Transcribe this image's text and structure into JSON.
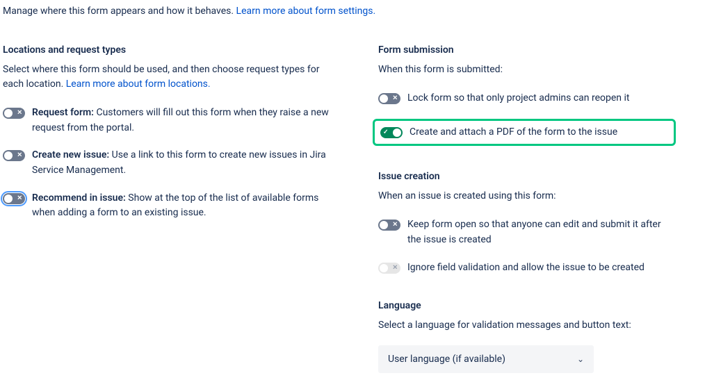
{
  "intro": {
    "text": "Manage where this form appears and how it behaves. ",
    "link": "Learn more about form settings."
  },
  "locations": {
    "title": "Locations and request types",
    "desc": "Select where this form should be used, and then choose request types for each location. ",
    "desc_link": "Learn more about form locations.",
    "items": [
      {
        "label": "Request form:",
        "text": " Customers will fill out this form when they raise a new request from the portal."
      },
      {
        "label": "Create new issue:",
        "text": " Use a link to this form to create new issues in Jira Service Management."
      },
      {
        "label": "Recommend in issue:",
        "text": " Show at the top of the list of available forms when adding a form to an existing issue."
      }
    ]
  },
  "submission": {
    "title": "Form submission",
    "desc": "When this form is submitted:",
    "items": [
      "Lock form so that only project admins can reopen it",
      "Create and attach a PDF of the form to the issue"
    ]
  },
  "creation": {
    "title": "Issue creation",
    "desc": "When an issue is created using this form:",
    "items": [
      "Keep form open so that anyone can edit and submit it after the issue is created",
      "Ignore field validation and allow the issue to be created"
    ]
  },
  "language": {
    "title": "Language",
    "desc": "Select a language for validation messages and button text:",
    "selected": "User language (if available)"
  }
}
